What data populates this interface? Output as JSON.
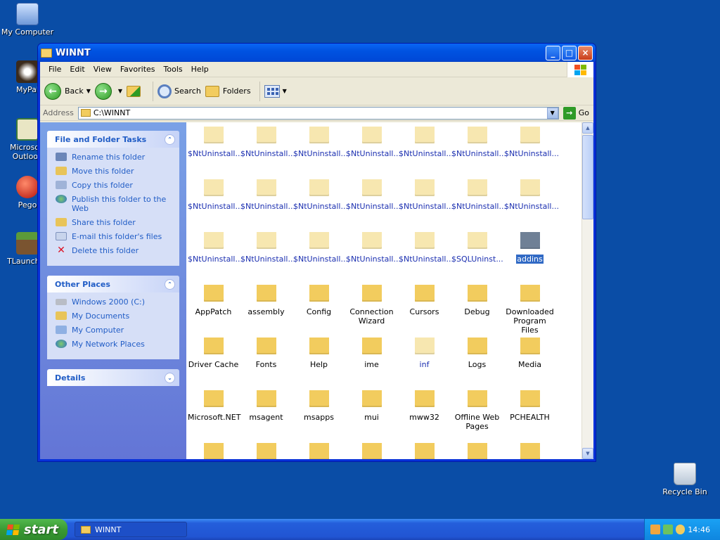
{
  "desktop": {
    "icons": [
      {
        "label": "My Computer",
        "icon": "computer-icon"
      },
      {
        "label": "MyPal",
        "icon": "mypal-icon"
      },
      {
        "label": "Microsoft Outlook",
        "icon": "outlook-icon"
      },
      {
        "label": "Pego",
        "icon": "pego-icon"
      },
      {
        "label": "TLauncher",
        "icon": "tlauncher-icon"
      },
      {
        "label": "Recycle Bin",
        "icon": "recycle-bin-icon"
      }
    ]
  },
  "window": {
    "title": "WINNT",
    "buttons": {
      "minimize": "_",
      "maximize": "□",
      "close": "×"
    }
  },
  "menu": [
    "File",
    "Edit",
    "View",
    "Favorites",
    "Tools",
    "Help"
  ],
  "toolbar": {
    "back": "Back",
    "search": "Search",
    "folders": "Folders"
  },
  "address": {
    "label": "Address",
    "value": "C:\\WINNT",
    "go": "Go"
  },
  "tasks_panel": {
    "title": "File and Folder Tasks",
    "items": [
      "Rename this folder",
      "Move this folder",
      "Copy this folder",
      "Publish this folder to the Web",
      "Share this folder",
      "E-mail this folder's files",
      "Delete this folder"
    ]
  },
  "places_panel": {
    "title": "Other Places",
    "items": [
      "Windows 2000 (C:)",
      "My Documents",
      "My Computer",
      "My Network Places"
    ]
  },
  "details_panel": {
    "title": "Details"
  },
  "files": [
    {
      "name": "$NtUninstall...",
      "sys": true
    },
    {
      "name": "$NtUninstall...",
      "sys": true
    },
    {
      "name": "$NtUninstall...",
      "sys": true
    },
    {
      "name": "$NtUninstall...",
      "sys": true
    },
    {
      "name": "$NtUninstall...",
      "sys": true
    },
    {
      "name": "$NtUninstall...",
      "sys": true
    },
    {
      "name": "$NtUninstall...",
      "sys": true
    },
    {
      "name": "$NtUninstall...",
      "sys": true
    },
    {
      "name": "$NtUninstall...",
      "sys": true
    },
    {
      "name": "$NtUninstall...",
      "sys": true
    },
    {
      "name": "$NtUninstall...",
      "sys": true
    },
    {
      "name": "$NtUninstall...",
      "sys": true
    },
    {
      "name": "$NtUninstall...",
      "sys": true
    },
    {
      "name": "$NtUninstall...",
      "sys": true
    },
    {
      "name": "$NtUninstall...",
      "sys": true
    },
    {
      "name": "$NtUninstall...",
      "sys": true
    },
    {
      "name": "$NtUninstall...",
      "sys": true
    },
    {
      "name": "$NtUninstall...",
      "sys": true
    },
    {
      "name": "$NtUninstall...",
      "sys": true
    },
    {
      "name": "$SQLUninst...",
      "sys": true
    },
    {
      "name": "addins",
      "selected": true
    },
    {
      "name": "AppPatch"
    },
    {
      "name": "assembly"
    },
    {
      "name": "Config"
    },
    {
      "name": "Connection Wizard"
    },
    {
      "name": "Cursors"
    },
    {
      "name": "Debug"
    },
    {
      "name": "Downloaded Program Files"
    },
    {
      "name": "Driver Cache"
    },
    {
      "name": "Fonts"
    },
    {
      "name": "Help"
    },
    {
      "name": "ime"
    },
    {
      "name": "inf",
      "sys": true
    },
    {
      "name": "Logs"
    },
    {
      "name": "Media"
    },
    {
      "name": "Microsoft.NET"
    },
    {
      "name": "msagent"
    },
    {
      "name": "msapps"
    },
    {
      "name": "mui"
    },
    {
      "name": "mww32"
    },
    {
      "name": "Offline Web Pages"
    },
    {
      "name": "PCHEALTH"
    },
    {
      "name": ""
    },
    {
      "name": ""
    },
    {
      "name": ""
    },
    {
      "name": ""
    },
    {
      "name": ""
    },
    {
      "name": ""
    },
    {
      "name": ""
    }
  ],
  "taskbar": {
    "start": "start",
    "task": "WINNT",
    "clock": "14:46"
  },
  "colors": {
    "desktop": "#0a4da6",
    "link": "#215dc6",
    "selection": "#316ac5",
    "folder": "#f2cc5e"
  }
}
